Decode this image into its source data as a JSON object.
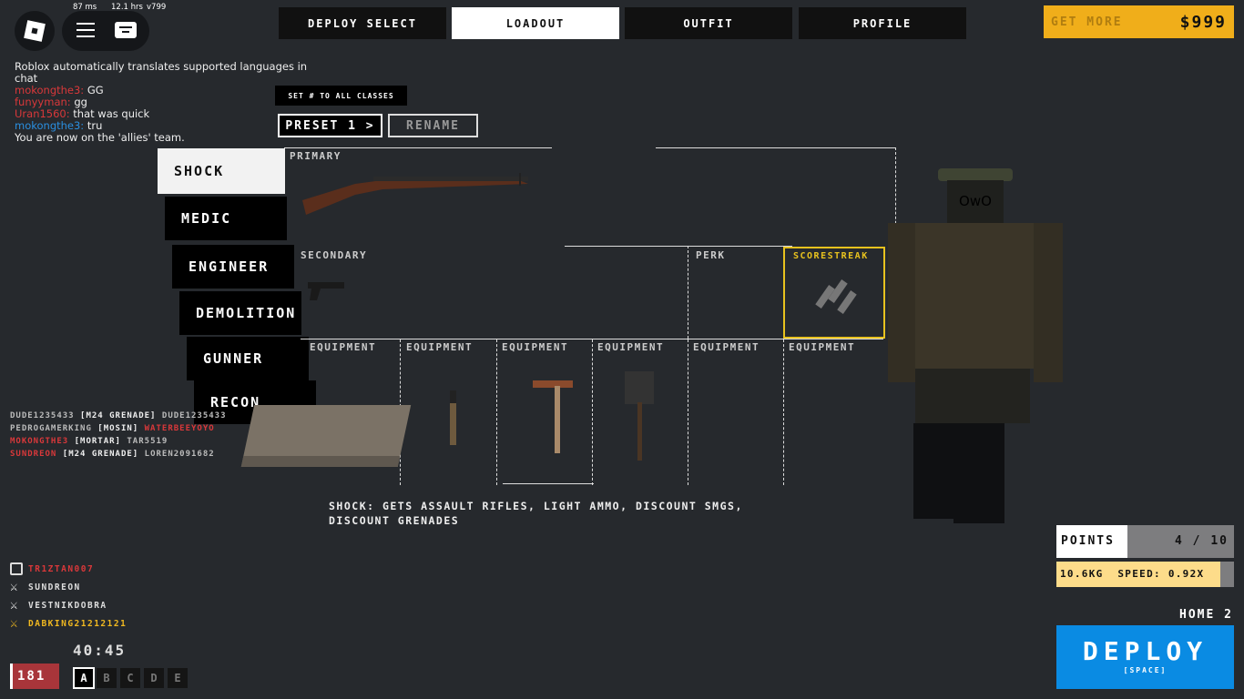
{
  "stats": {
    "ping": "87 ms",
    "playtime": "12.1 hrs",
    "version": "v799"
  },
  "nav_tabs": [
    {
      "label": "DEPLOY SELECT"
    },
    {
      "label": "LOADOUT"
    },
    {
      "label": "OUTFIT"
    },
    {
      "label": "PROFILE"
    }
  ],
  "currency": {
    "get_more": "GET MORE",
    "amount": "$999"
  },
  "chat": {
    "system": "Roblox automatically translates supported languages in chat",
    "messages": [
      {
        "user": "mokongthe3:",
        "text": "GG",
        "color": "#d9383a"
      },
      {
        "user": "funyyman:",
        "text": "gg",
        "color": "#d9383a"
      },
      {
        "user": "Uran1560:",
        "text": "that was quick",
        "color": "#d9383a"
      },
      {
        "user": "mokongthe3:",
        "text": "tru",
        "color": "#2a8fe0"
      }
    ],
    "team_notice": "You are now on the 'allies' team."
  },
  "preset": {
    "set_all": "SET # TO ALL CLASSES",
    "preset": "PRESET 1 >",
    "rename": "RENAME"
  },
  "classes": [
    "SHOCK",
    "MEDIC",
    "ENGINEER",
    "DEMOLITION",
    "GUNNER",
    "RECON"
  ],
  "slots": {
    "primary": "PRIMARY",
    "secondary": "SECONDARY",
    "perk": "PERK",
    "scorestreak": "SCORESTREAK",
    "equipment": [
      "EQUIPMENT",
      "EQUIPMENT",
      "EQUIPMENT",
      "EQUIPMENT",
      "EQUIPMENT",
      "EQUIPMENT"
    ]
  },
  "class_desc": "SHOCK:  GETS ASSAULT RIFLES, LIGHT AMMO, DISCOUNT SMGS, DISCOUNT GRENADES",
  "character": {
    "face": "OwO"
  },
  "killfeed": [
    {
      "killer": "DUDE1235433",
      "weapon": "[M24 GRENADE]",
      "victim": "DUDE1235433",
      "kc": "",
      "vc": ""
    },
    {
      "killer": "PEDROGAMERKING",
      "weapon": "[MOSIN]",
      "victim": "WATERBEEYOYO",
      "kc": "",
      "vc": "red"
    },
    {
      "killer": "MOKONGTHE3",
      "weapon": "[MORTAR]",
      "victim": "TAR5519",
      "kc": "red",
      "vc": ""
    },
    {
      "killer": "SUNDREON",
      "weapon": "[M24 GRENADE]",
      "victim": "LOREN2091682",
      "kc": "red",
      "vc": ""
    }
  ],
  "scoreboard": [
    {
      "name": "TR1ZTAN007",
      "icon": "skull-icon",
      "color": "#d9383a"
    },
    {
      "name": "SUNDREON",
      "icon": "sword-icon",
      "color": "#ddd"
    },
    {
      "name": "VESTNIKDOBRA",
      "icon": "sword-icon",
      "color": "#ddd"
    },
    {
      "name": "DABKING21212121",
      "icon": "sword-icon",
      "color": "#f0b820"
    }
  ],
  "timer": "40:45",
  "ticket": "181",
  "points_sel": [
    "A",
    "B",
    "C",
    "D",
    "E"
  ],
  "points": {
    "label": "POINTS",
    "value": "4 / 10",
    "fraction": 0.4
  },
  "weight": {
    "text": "10.6KG  SPEED: 0.92X"
  },
  "spawn": "HOME 2",
  "deploy": {
    "label": "DEPLOY",
    "hint": "[SPACE]"
  },
  "colors": {
    "accent": "#f0ae1a",
    "deploy": "#0a8be3",
    "scorestreak": "#e8c21e"
  }
}
